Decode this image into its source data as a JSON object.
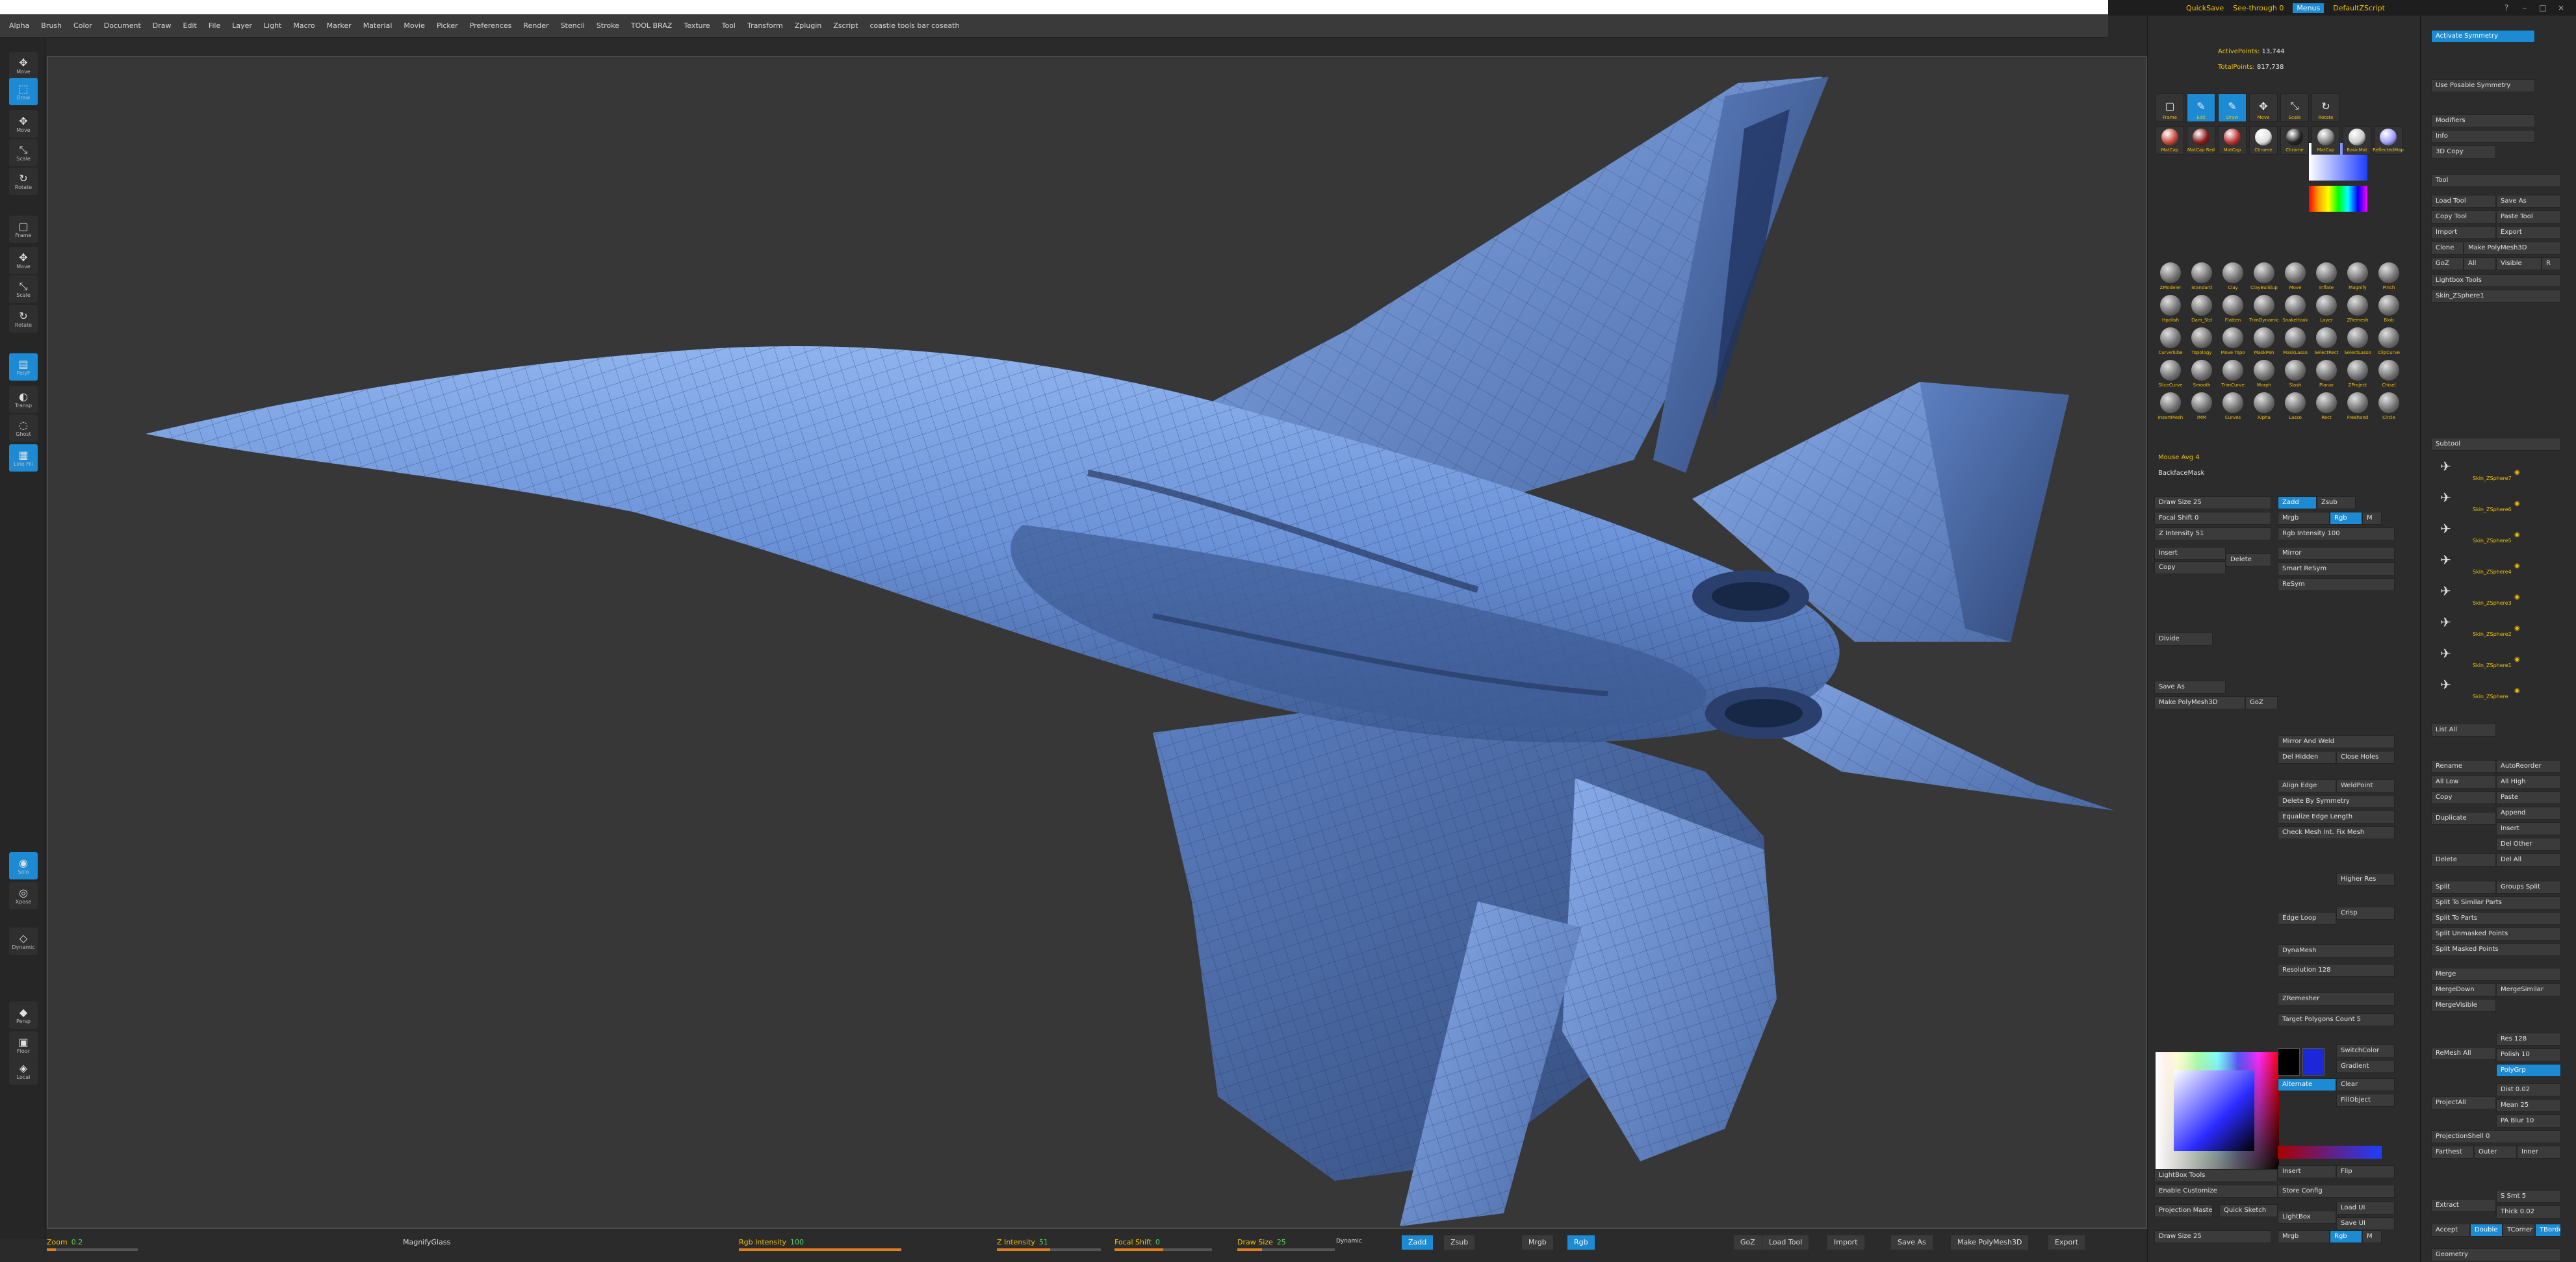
{
  "menu": [
    "Alpha",
    "Brush",
    "Color",
    "Document",
    "Draw",
    "Edit",
    "File",
    "Layer",
    "Light",
    "Macro",
    "Marker",
    "Material",
    "Movie",
    "Picker",
    "Preferences",
    "Render",
    "Stencil",
    "Stroke",
    "TOOL BRAZ",
    "Texture",
    "Tool",
    "Transform",
    "Zplugin",
    "Zscript",
    "coastie tools bar coseath"
  ],
  "topright": {
    "quicksave": "QuickSave",
    "seethrough": "See-through 0",
    "menus": "Menus",
    "script": "DefaultZScript"
  },
  "left_shelf": [
    {
      "icon": "✥",
      "label": "Move"
    },
    {
      "icon": "⬚",
      "label": "Draw"
    },
    {
      "icon": "✥",
      "label": "Move"
    },
    {
      "icon": "⤡",
      "label": "Scale"
    },
    {
      "icon": "↻",
      "label": "Rotate"
    },
    {
      "icon": "▢",
      "label": "Frame"
    },
    {
      "icon": "✥",
      "label": "Move"
    },
    {
      "icon": "⤡",
      "label": "Scale"
    },
    {
      "icon": "↻",
      "label": "Rotate"
    },
    {
      "icon": "▤",
      "label": "PolyF"
    },
    {
      "icon": "◐",
      "label": "Transp"
    },
    {
      "icon": "◌",
      "label": "Ghost"
    },
    {
      "icon": "▦",
      "label": "Line Fill"
    },
    {
      "icon": "◉",
      "label": "Solo"
    },
    {
      "icon": "◎",
      "label": "Xpose"
    },
    {
      "icon": "◇",
      "label": "Dynamic"
    },
    {
      "icon": "◆",
      "label": "Persp"
    },
    {
      "icon": "▣",
      "label": "Floor"
    },
    {
      "icon": "◈",
      "label": "Local"
    }
  ],
  "bottom": {
    "zoom_label": "Zoom",
    "zoom_value": "0.2",
    "magnify": "MagnifyGlass",
    "rgb_label": "Rgb Intensity",
    "rgb_value": "100",
    "z_label": "Z Intensity",
    "z_value": "51",
    "focal_label": "Focal Shift",
    "focal_value": "0",
    "draw_label": "Draw Size",
    "draw_value": "25",
    "dynamic": "Dynamic",
    "buttons": [
      "Zadd",
      "Zsub",
      "Mrgb",
      "Rgb"
    ],
    "tool_buttons": [
      "GoZ",
      "Load Tool",
      "Import",
      "Save As",
      "Make PolyMesh3D",
      "Export"
    ]
  },
  "info_panel": {
    "active_points_label": "ActivePoints:",
    "active_points": "13,744",
    "total_points_label": "TotalPoints:",
    "total_points": "817,738"
  },
  "tool_tiles": [
    {
      "label": "Frame",
      "icon": "▢"
    },
    {
      "label": "Edit",
      "icon": "✎",
      "on": true
    },
    {
      "label": "Draw",
      "icon": "✎",
      "on": true
    },
    {
      "label": "Move",
      "icon": "✥"
    },
    {
      "label": "Scale",
      "icon": "⤡"
    },
    {
      "label": "Rotate",
      "icon": "↻"
    }
  ],
  "materials": [
    "MatCap",
    "MatCap Red",
    "MatCap",
    "Chrome",
    "Chrome",
    "MatCap",
    "BasicMat",
    "ReflectedMap"
  ],
  "brushes": [
    "ZModeler",
    "Standard",
    "Clay",
    "ClayBuildup",
    "Move",
    "Inflate",
    "Magnify",
    "Pinch",
    "Hpolish",
    "Dam_Std",
    "Flatten",
    "TrimDynamic",
    "SnakeHook",
    "Layer",
    "ZRemesh",
    "Blob",
    "CurveTube",
    "Topology",
    "Move Topo",
    "MaskPen",
    "MaskLasso",
    "SelectRect",
    "SelectLasso",
    "ClipCurve",
    "SliceCurve",
    "Smooth",
    "TrimCurve",
    "Morph",
    "Slash",
    "Planar",
    "ZProject",
    "Chisel",
    "InsertMesh",
    "IMM",
    "Curves",
    "Alpha",
    "Lasso",
    "Rect",
    "Freehand",
    "Circle"
  ],
  "mouse_avg": "Mouse Avg 4",
  "backface": "BackfaceMask",
  "panel_rows": {
    "draw_size": "Draw Size 25",
    "focal_shift": "Focal Shift 0",
    "z_intensity": "Z Intensity 51",
    "rgb_intensity": "Rgb Intensity 100",
    "mrgb": "Mrgb",
    "rgb": "Rgb",
    "m": "M",
    "zadd": "Zadd",
    "zsub": "Zsub",
    "insert": "Insert",
    "copy": "Copy",
    "delete": "Delete",
    "mirror": "Mirror",
    "smart_resym": "Smart ReSym",
    "resym": "ReSym",
    "divide": "Divide",
    "save_as": "Save As",
    "make_polymesh": "Make PolyMesh3D",
    "goz": "GoZ",
    "mirror_weld": "Mirror And Weld",
    "del_hidden": "Del Hidden",
    "close_holes": "Close Holes",
    "weldpoint": "WeldPoint",
    "align_edge": "Align Edge",
    "delete_by_sym": "Delete By Symmetry",
    "equalize": "Equalize Edge Length",
    "check_mesh": "Check Mesh Int. Fix Mesh",
    "higher_res": "Higher Res",
    "edge_loop": "Edge Loop",
    "crisp": "Crisp",
    "dynamesh": "DynaMesh",
    "resolution": "Resolution 128",
    "zremesher": "ZRemesher",
    "target_poly": "Target Polygons Count 5",
    "switchcolor": "SwitchColor",
    "gradient": "Gradient",
    "alternate": "Alternate",
    "clear": "Clear",
    "fillobject": "FillObject",
    "lightbox_tools": "LightBox Tools",
    "enable_customize": "Enable Customize",
    "projection_master": "Projection Master",
    "quick_sketch": "Quick Sketch",
    "store_config": "Store Config",
    "lightbox": "LightBox",
    "load_ui": "Load UI",
    "save_ui": "Save UI",
    "flip": "Flip",
    "insert2": "Insert",
    "draw_size2": "Draw Size 25",
    "mrgb2": "Mrgb",
    "rgb2": "Rgb",
    "m2": "M"
  },
  "tool_panel": {
    "activate_symmetry": "Activate Symmetry",
    "use_posable": "Use Posable Symmetry",
    "modifiers": "Modifiers",
    "info": "Info",
    "copy_3d": "3D Copy",
    "tool": "Tool",
    "load_tool": "Load Tool",
    "save_as": "Save As",
    "copy_tool": "Copy Tool",
    "paste_tool": "Paste Tool",
    "import": "Import",
    "export": "Export",
    "clone": "Clone",
    "make_polymesh": "Make PolyMesh3D",
    "goz": "GoZ",
    "all": "All",
    "visible": "Visible",
    "r": "R",
    "lightbox_tools": "Lightbox Tools",
    "current_tool": "Skin_ZSphere1",
    "subtool": "Subtool",
    "subtools": [
      "Skin_ZSphere7",
      "Skin_ZSphere6",
      "Skin_ZSphere5",
      "Skin_ZSphere4",
      "Skin_ZSphere3",
      "Skin_ZSphere2",
      "Skin_ZSphere1",
      "Skin_ZSphere"
    ],
    "list_all": "List All",
    "rename": "Rename",
    "autoreorder": "AutoReorder",
    "all_low": "All Low",
    "all_high": "All High",
    "copy": "Copy",
    "paste": "Paste",
    "duplicate": "Duplicate",
    "append": "Append",
    "insert": "Insert",
    "delete": "Delete",
    "del_other": "Del Other",
    "del_all": "Del All",
    "split": "Split",
    "groups_split": "Groups Split",
    "split_similar": "Split To Similar Parts",
    "split_parts": "Split To Parts",
    "split_unmasked": "Split Unmasked Points",
    "split_masked": "Split Masked Points",
    "merge": "Merge",
    "mergedown": "MergeDown",
    "mergesimilar": "MergeSimilar",
    "mergevisible": "MergeVisible",
    "remesh_all": "ReMesh All",
    "res": "Res 128",
    "polish": "Polish 10",
    "polygroup": "PolyGrp",
    "project_all": "ProjectAll",
    "dist": "Dist 0.02",
    "mean": "Mean 25",
    "pa_blur": "PA Blur 10",
    "projection_shell": "ProjectionShell 0",
    "farthest": "Farthest",
    "outer": "Outer",
    "inner": "Inner",
    "extract": "Extract",
    "s_smt": "S Smt 5",
    "thick": "Thick 0.02",
    "accept": "Accept",
    "double": "Double",
    "tcorner": "TCorner",
    "tborder": "TBorder",
    "geometry": "Geometry"
  },
  "colors": {
    "accent": "#1d8bd4",
    "slider": "#e27e1e",
    "label_yellow": "#f0c000",
    "value_green": "#57d65a",
    "model": "#6d95d8"
  }
}
